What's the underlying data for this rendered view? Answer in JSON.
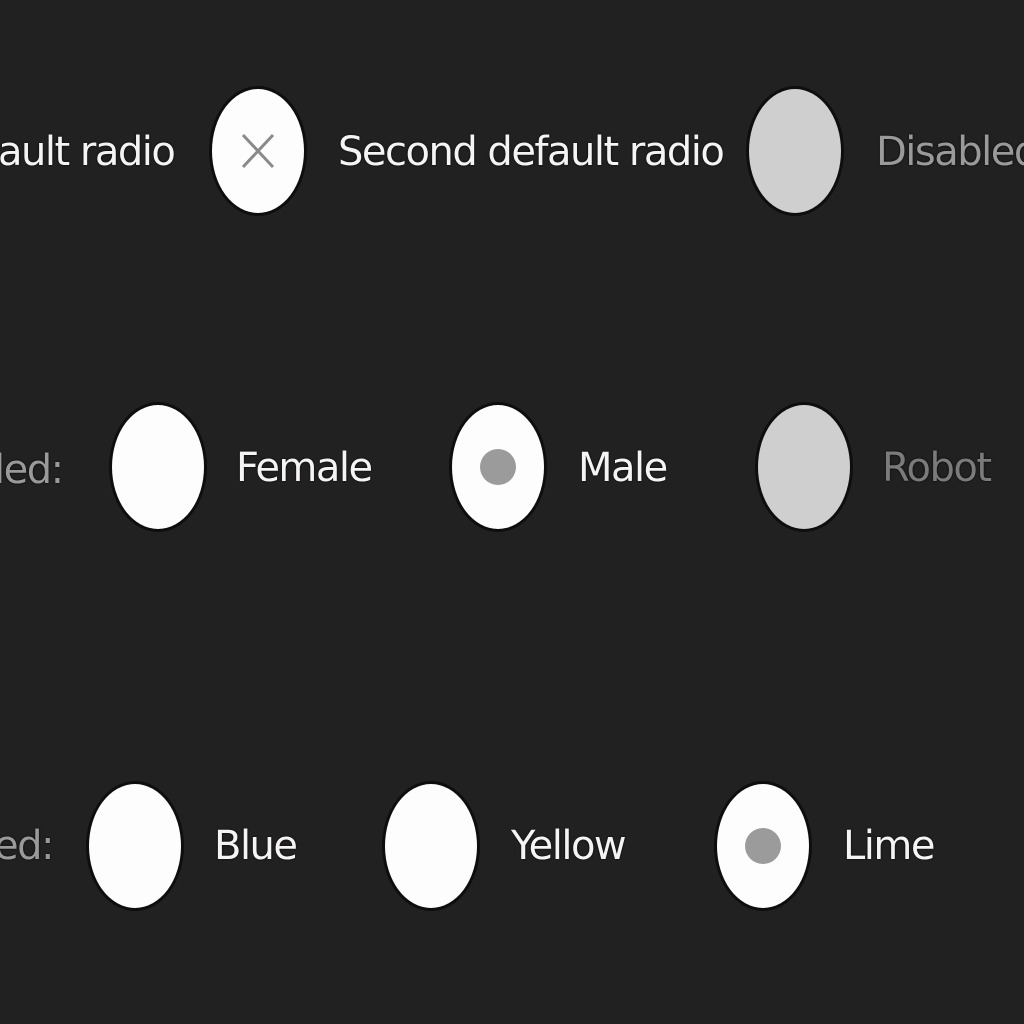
{
  "colors": {
    "background": "#222121",
    "radio_fill": "#fdfdfd",
    "radio_disabled_fill": "#cfcfcf",
    "dot": "#9b9b9b",
    "label_text": "#f4f4f4",
    "label_muted": "#9a9a9a",
    "label_disabled": "#7b7b7b"
  },
  "row1": {
    "first_label": "ault radio",
    "second_label": "Second default radio",
    "second_icon": "x-mark-icon",
    "disabled_label": "Disabled"
  },
  "row2": {
    "prefix": "led:",
    "options": [
      {
        "label": "Female",
        "checked": false,
        "disabled": false
      },
      {
        "label": "Male",
        "checked": true,
        "disabled": false
      },
      {
        "label": "Robot",
        "checked": false,
        "disabled": true
      }
    ]
  },
  "row3": {
    "prefix": "ed:",
    "options": [
      {
        "label": "Blue",
        "checked": false,
        "disabled": false
      },
      {
        "label": "Yellow",
        "checked": false,
        "disabled": false
      },
      {
        "label": "Lime",
        "checked": true,
        "disabled": false
      }
    ]
  }
}
